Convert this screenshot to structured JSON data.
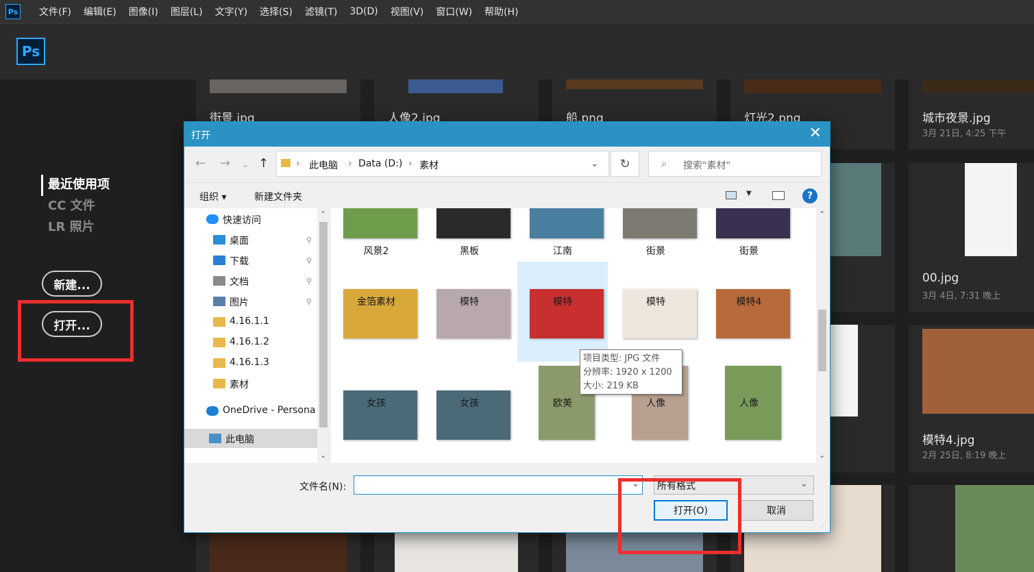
{
  "app": {
    "logo_small": "Ps",
    "logo_large": "Ps",
    "menus": [
      "文件(F)",
      "编辑(E)",
      "图像(I)",
      "图层(L)",
      "文字(Y)",
      "选择(S)",
      "滤镜(T)",
      "3D(D)",
      "视图(V)",
      "窗口(W)",
      "帮助(H)"
    ]
  },
  "leftnav": {
    "items": [
      "最近使用项",
      "CC 文件",
      "LR 照片"
    ],
    "new_button": "新建...",
    "open_button": "打开..."
  },
  "recent": [
    {
      "name": "街景.jpg"
    },
    {
      "name": "人像2.jpg"
    },
    {
      "name": "船.png"
    },
    {
      "name": "灯光2.png"
    },
    {
      "name": "城市夜景.jpg",
      "date": "3月 21日, 4:25 下午"
    },
    {
      "name": "00.jpg",
      "date": "3月 4日, 7:31 晚上"
    },
    {
      "name": "模特4.jpg",
      "date": "2月 25日, 8:19 晚上"
    }
  ],
  "dialog": {
    "title": "打开",
    "close": "✕",
    "breadcrumb": [
      "此电脑",
      "Data (D:)",
      "素材"
    ],
    "search_placeholder": "搜索\"素材\"",
    "toolbar": {
      "organize": "组织 ▾",
      "new_folder": "新建文件夹",
      "help": "?"
    },
    "tree": [
      {
        "label": "快速访问",
        "icon": "star-icon",
        "color": "#1e90ff"
      },
      {
        "label": "桌面",
        "icon": "desktop-icon",
        "color": "#2a8fd6",
        "pinned": true
      },
      {
        "label": "下载",
        "icon": "download-icon",
        "color": "#2a7fd6",
        "pinned": true
      },
      {
        "label": "文档",
        "icon": "document-icon",
        "color": "#8a8a8a",
        "pinned": true
      },
      {
        "label": "图片",
        "icon": "picture-icon",
        "color": "#5a7fa8",
        "pinned": true
      },
      {
        "label": "4.16.1.1",
        "icon": "folder-icon",
        "color": "#e8b84a"
      },
      {
        "label": "4.16.1.2",
        "icon": "folder-icon",
        "color": "#e8b84a"
      },
      {
        "label": "4.16.1.3",
        "icon": "folder-icon",
        "color": "#e8b84a"
      },
      {
        "label": "素材",
        "icon": "folder-icon",
        "color": "#e8b84a"
      },
      {
        "label": "OneDrive - Persona",
        "icon": "cloud-icon",
        "color": "#1e7fd6"
      },
      {
        "label": "此电脑",
        "icon": "computer-icon",
        "color": "#4a90c8",
        "selected": true
      }
    ],
    "files": [
      {
        "label": "风景2",
        "color": "#6e9c4a"
      },
      {
        "label": "黑板",
        "color": "#2a2a28"
      },
      {
        "label": "江南",
        "color": "#4a7fa0"
      },
      {
        "label": "街景",
        "color": "#7d7a74"
      },
      {
        "label": "街景",
        "color": "#3a3050"
      },
      {
        "label": "金箔素材",
        "color": "#d8a83a"
      },
      {
        "label": "模特",
        "color": "#b8a8ae"
      },
      {
        "label": "模特",
        "color": "#c83030",
        "selected": true
      },
      {
        "label": "模特",
        "color": "#eee6dc"
      },
      {
        "label": "模特4",
        "color": "#b86a3a"
      },
      {
        "label": "女孩",
        "color": "#4a6a78"
      },
      {
        "label": "女孩",
        "color": "#4a6a78"
      },
      {
        "label": "欧美",
        "color": "#8a9a6a"
      },
      {
        "label": "人像",
        "color": "#b8a090"
      },
      {
        "label": "人像",
        "color": "#7a9a5a"
      }
    ],
    "tooltip": [
      "项目类型: JPG 文件",
      "分辨率: 1920 x 1200",
      "大小: 219 KB"
    ],
    "filename_label": "文件名(N):",
    "filename_value": "",
    "format_value": "所有格式",
    "open_button": "打开(O)",
    "cancel_button": "取消"
  }
}
